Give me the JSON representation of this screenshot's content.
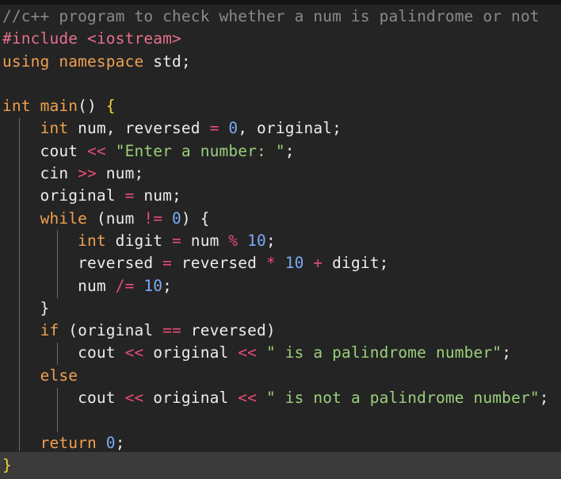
{
  "editor": {
    "language": "C++",
    "lines": [
      [
        {
          "t": "//c++ program to check whether a num is palindrome or not",
          "c": "cm"
        }
      ],
      [
        {
          "t": "#include",
          "c": "pp"
        },
        {
          "t": " ",
          "c": "plain"
        },
        {
          "t": "<iostream>",
          "c": "pp"
        }
      ],
      [
        {
          "t": "using",
          "c": "kw"
        },
        {
          "t": " ",
          "c": "plain"
        },
        {
          "t": "namespace",
          "c": "kw"
        },
        {
          "t": " std;",
          "c": "plain"
        }
      ],
      [],
      [
        {
          "t": "int",
          "c": "kw"
        },
        {
          "t": " ",
          "c": "plain"
        },
        {
          "t": "main",
          "c": "kw"
        },
        {
          "t": "() ",
          "c": "plain"
        },
        {
          "t": "{",
          "c": "brace"
        }
      ],
      [
        {
          "t": "    ",
          "c": "plain"
        },
        {
          "t": "int",
          "c": "kw"
        },
        {
          "t": " num, reversed ",
          "c": "plain"
        },
        {
          "t": "=",
          "c": "op"
        },
        {
          "t": " ",
          "c": "plain"
        },
        {
          "t": "0",
          "c": "num"
        },
        {
          "t": ", original;",
          "c": "plain"
        }
      ],
      [
        {
          "t": "    cout ",
          "c": "plain"
        },
        {
          "t": "<<",
          "c": "op"
        },
        {
          "t": " ",
          "c": "plain"
        },
        {
          "t": "\"Enter a number: \"",
          "c": "str"
        },
        {
          "t": ";",
          "c": "plain"
        }
      ],
      [
        {
          "t": "    cin ",
          "c": "plain"
        },
        {
          "t": ">>",
          "c": "op"
        },
        {
          "t": " num;",
          "c": "plain"
        }
      ],
      [
        {
          "t": "    original ",
          "c": "plain"
        },
        {
          "t": "=",
          "c": "op"
        },
        {
          "t": " num;",
          "c": "plain"
        }
      ],
      [
        {
          "t": "    ",
          "c": "plain"
        },
        {
          "t": "while",
          "c": "kw"
        },
        {
          "t": " (num ",
          "c": "plain"
        },
        {
          "t": "!=",
          "c": "op"
        },
        {
          "t": " ",
          "c": "plain"
        },
        {
          "t": "0",
          "c": "num"
        },
        {
          "t": ") {",
          "c": "plain"
        }
      ],
      [
        {
          "t": "        ",
          "c": "plain"
        },
        {
          "t": "int",
          "c": "kw"
        },
        {
          "t": " digit ",
          "c": "plain"
        },
        {
          "t": "=",
          "c": "op"
        },
        {
          "t": " num ",
          "c": "plain"
        },
        {
          "t": "%",
          "c": "op"
        },
        {
          "t": " ",
          "c": "plain"
        },
        {
          "t": "10",
          "c": "num"
        },
        {
          "t": ";",
          "c": "plain"
        }
      ],
      [
        {
          "t": "        reversed ",
          "c": "plain"
        },
        {
          "t": "=",
          "c": "op"
        },
        {
          "t": " reversed ",
          "c": "plain"
        },
        {
          "t": "*",
          "c": "op"
        },
        {
          "t": " ",
          "c": "plain"
        },
        {
          "t": "10",
          "c": "num"
        },
        {
          "t": " ",
          "c": "plain"
        },
        {
          "t": "+",
          "c": "op"
        },
        {
          "t": " digit;",
          "c": "plain"
        }
      ],
      [
        {
          "t": "        num ",
          "c": "plain"
        },
        {
          "t": "/=",
          "c": "op"
        },
        {
          "t": " ",
          "c": "plain"
        },
        {
          "t": "10",
          "c": "num"
        },
        {
          "t": ";",
          "c": "plain"
        }
      ],
      [
        {
          "t": "    }",
          "c": "plain"
        }
      ],
      [
        {
          "t": "    ",
          "c": "plain"
        },
        {
          "t": "if",
          "c": "kw"
        },
        {
          "t": " (original ",
          "c": "plain"
        },
        {
          "t": "==",
          "c": "op"
        },
        {
          "t": " reversed)",
          "c": "plain"
        }
      ],
      [
        {
          "t": "        cout ",
          "c": "plain"
        },
        {
          "t": "<<",
          "c": "op"
        },
        {
          "t": " original ",
          "c": "plain"
        },
        {
          "t": "<<",
          "c": "op"
        },
        {
          "t": " ",
          "c": "plain"
        },
        {
          "t": "\" is a palindrome number\"",
          "c": "str"
        },
        {
          "t": ";",
          "c": "plain"
        }
      ],
      [
        {
          "t": "    ",
          "c": "plain"
        },
        {
          "t": "else",
          "c": "kw"
        }
      ],
      [
        {
          "t": "        cout ",
          "c": "plain"
        },
        {
          "t": "<<",
          "c": "op"
        },
        {
          "t": " original ",
          "c": "plain"
        },
        {
          "t": "<<",
          "c": "op"
        },
        {
          "t": " ",
          "c": "plain"
        },
        {
          "t": "\" is not a palindrome number\"",
          "c": "str"
        },
        {
          "t": ";",
          "c": "plain"
        }
      ],
      [],
      [
        {
          "t": "    ",
          "c": "plain"
        },
        {
          "t": "return",
          "c": "kw"
        },
        {
          "t": " ",
          "c": "plain"
        },
        {
          "t": "0",
          "c": "num"
        },
        {
          "t": ";",
          "c": "plain"
        }
      ],
      [
        {
          "t": "}",
          "c": "brace"
        }
      ]
    ]
  }
}
